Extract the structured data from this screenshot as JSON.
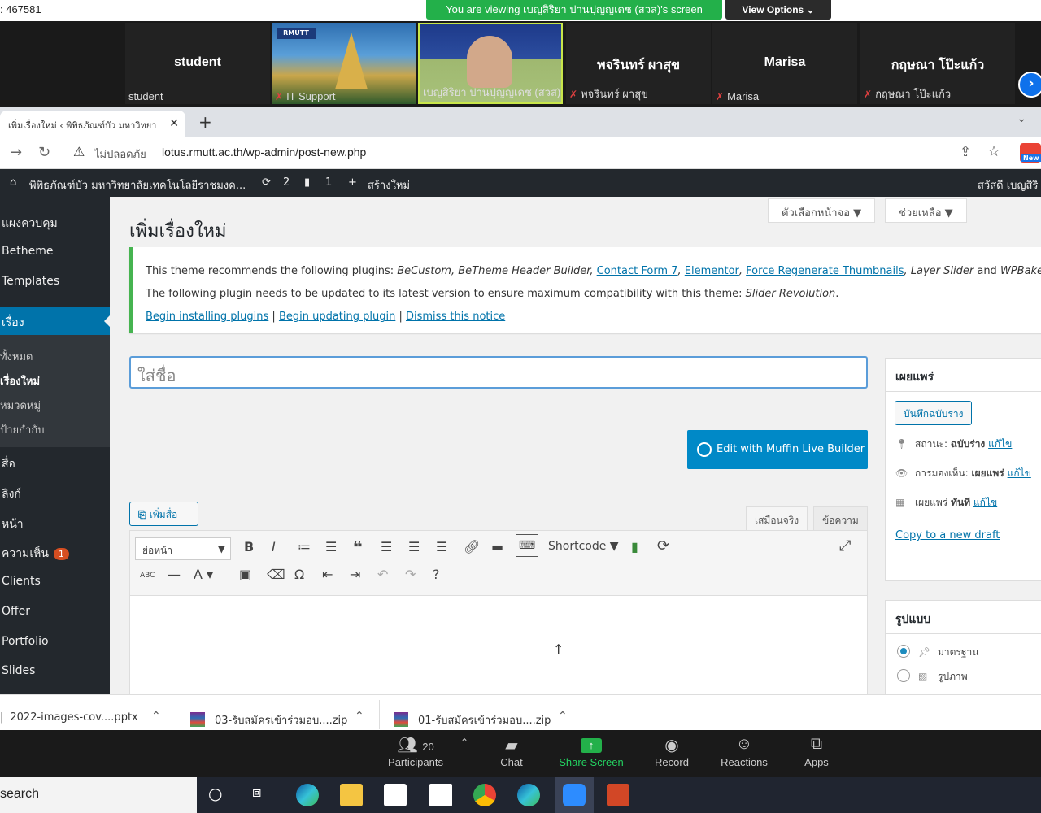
{
  "zoom": {
    "meeting_id": ": 467581",
    "viewing_banner": "You are viewing เบญสิริยา ปานปุญญเดช (สวส)'s screen",
    "view_options": "View Options ⌄",
    "tiles": [
      {
        "big": "student",
        "small": "student",
        "muted": false
      },
      {
        "big": "",
        "small": "IT Support",
        "muted": true
      },
      {
        "big": "",
        "small": "เบญสิริยา ปานปุญญเดช (สวส)",
        "muted": false
      },
      {
        "big": "พจรินทร์ ผาสุข",
        "small": "พจรินทร์ ผาสุข",
        "muted": true
      },
      {
        "big": "Marisa",
        "small": "Marisa",
        "muted": true
      },
      {
        "big": "กฤษณา โป๊ะแก้ว",
        "small": "กฤษณา โป๊ะแก้ว",
        "muted": true
      }
    ],
    "bottom": {
      "participants_label": "Participants",
      "participants_count": "20",
      "chat": "Chat",
      "share": "Share Screen",
      "record": "Record",
      "reactions": "Reactions",
      "apps": "Apps"
    },
    "accent": "#0e71eb",
    "banner_color": "#23b04a"
  },
  "browser": {
    "tab_title": "เพิ่มเรื่องใหม่ ‹ พิพิธภัณฑ์บัว มหาวิทยา",
    "insecure_label": "ไม่ปลอดภัย",
    "url": "lotus.rmutt.ac.th/wp-admin/post-new.php",
    "ext_badge": "New"
  },
  "adminbar": {
    "site": "พิพิธภัณฑ์บัว มหาวิทยาลัยเทคโนโลยีราชมงค...",
    "updates": "2",
    "comments": "1",
    "new": "สร้างใหม่",
    "greeting": "สวัสดี เบญสิริ"
  },
  "sidebar": {
    "items": [
      "แผงควบคุม",
      "Betheme",
      "Templates",
      "เรื่อง",
      "สื่อ",
      "ลิงก์",
      "หน้า",
      "ความเห็น",
      "Clients",
      "Offer",
      "Portfolio",
      "Slides"
    ],
    "submenu": [
      "ทั้งหมด",
      "เรื่องใหม่",
      "หมวดหมู่",
      "ป้ายกำกับ"
    ],
    "comments_badge": "1"
  },
  "main": {
    "screen_options": "ตัวเลือกหน้าจอ ▼",
    "help": "ช่วยเหลือ ▼",
    "page_title": "เพิ่มเรื่องใหม่",
    "notice": {
      "line1_prefix": "This theme recommends the following plugins: ",
      "p1": "BeCustom, BeTheme Header Builder, ",
      "p2": "Contact Form 7",
      "p3": "Elementor",
      "p4": "Force Regenerate Thumbnails",
      "p5": ", Layer Slider",
      "line1_suffix": " and ",
      "p6": "WPBakery Page",
      "line2_prefix": "The following plugin needs to be updated to its latest version to ensure maximum compatibility with this theme: ",
      "line2_plugin": "Slider Revolution",
      "link_install": "Begin installing plugins",
      "link_update": "Begin updating plugin",
      "link_dismiss": "Dismiss this notice"
    },
    "title_placeholder": "ใส่ชื่อ",
    "muffin_button": "Edit with Muffin Live Builder",
    "add_media": "เพิ่มสื่อ",
    "tab_visual": "เสมือนจริง",
    "tab_text": "ข้อความ",
    "format_select": "ย่อหน้า",
    "shortcode": "Shortcode ▼"
  },
  "publish": {
    "heading": "เผยแพร่",
    "save_draft": "บันทึกฉบับร่าง",
    "status_label": "สถานะ: ",
    "status_value": "ฉบับร่าง",
    "visibility_label": "การมองเห็น: ",
    "visibility_value": "เผยแพร่",
    "publish_label": "เผยแพร่ ",
    "publish_value": "ทันที",
    "edit": "แก้ไข",
    "copy_draft": "Copy to a new draft"
  },
  "format": {
    "heading": "รูปแบบ",
    "options": [
      "มาตรฐาน",
      "รูปภาพ"
    ]
  },
  "downloads": [
    "2022-images-cov....pptx",
    "03-รับสมัครเข้าร่วมอบ....zip",
    "01-รับสมัครเข้าร่วมอบ....zip"
  ],
  "taskbar": {
    "search": "search"
  }
}
